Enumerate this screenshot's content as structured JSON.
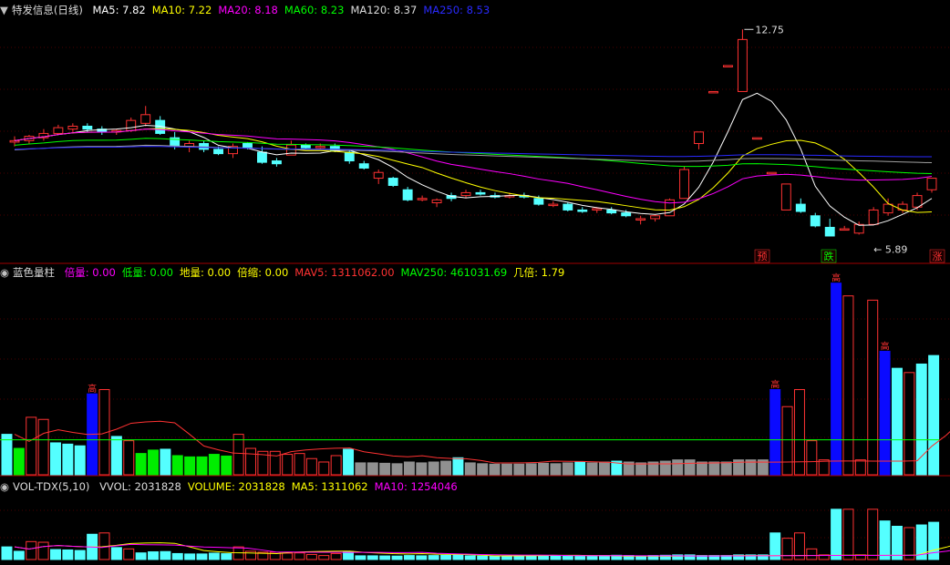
{
  "colors": {
    "up": "#ff3232",
    "down": "#54ffff",
    "ma5": "#ffffff",
    "ma10": "#ffff00",
    "ma20": "#ff00ff",
    "ma60": "#00ff00",
    "ma120": "#a0a0a0",
    "ma250": "#2a2aff",
    "grid": "#4a0000",
    "sep": "#a00000",
    "blue": "#0a0aff",
    "green": "#00ee00",
    "gray": "#909090",
    "orange": "#ff9900"
  },
  "panel1": {
    "title": "特发信息(日线)",
    "ma": [
      {
        "label": "MA5: 7.82",
        "color": "#ffffff"
      },
      {
        "label": "MA10: 7.22",
        "color": "#ffff00"
      },
      {
        "label": "MA20: 8.18",
        "color": "#ff00ff"
      },
      {
        "label": "MA60: 8.23",
        "color": "#00ff00"
      },
      {
        "label": "MA120: 8.37",
        "color": "#dcdcdc"
      },
      {
        "label": "MA250: 8.53",
        "color": "#2a2aff"
      }
    ],
    "high_label": "12.75",
    "low_label": "5.89",
    "markers": [
      {
        "text": "预",
        "color": "#ff3232",
        "index": 33
      },
      {
        "text": "跌",
        "color": "#00ff00",
        "index": 36
      },
      {
        "text": "涨",
        "color": "#ff3232",
        "index": 41
      }
    ]
  },
  "panel2": {
    "title": "蓝色量柱",
    "stats": [
      {
        "label": "倍量: 0.00",
        "color": "#ff00ff"
      },
      {
        "label": "低量: 0.00",
        "color": "#00ff00"
      },
      {
        "label": "地量: 0.00",
        "color": "#ffff00"
      },
      {
        "label": "倍缩: 0.00",
        "color": "#ffff00"
      },
      {
        "label": "MAV5: 1311062.00",
        "color": "#ff3232"
      },
      {
        "label": "MAV250: 461031.69",
        "color": "#00ff00"
      },
      {
        "label": "几倍: 1.79",
        "color": "#ffff00"
      }
    ],
    "gao": "高"
  },
  "panel3": {
    "title": "VOL-TDX(5,10)",
    "stats": [
      {
        "label": "VVOL: 2031828",
        "color": "#dcdcdc"
      },
      {
        "label": "VOLUME: 2031828",
        "color": "#ffff00"
      },
      {
        "label": "MA5: 1311062",
        "color": "#ffff00"
      },
      {
        "label": "MA10: 1254046",
        "color": "#ff00ff"
      }
    ]
  },
  "chart_data": {
    "type": "candlestick",
    "ylim": [
      5.0,
      13.2
    ],
    "candles": [
      {
        "o": 8.85,
        "h": 9.05,
        "l": 8.7,
        "c": 8.9
      },
      {
        "o": 8.9,
        "h": 9.1,
        "l": 8.8,
        "c": 9.05
      },
      {
        "o": 9.0,
        "h": 9.3,
        "l": 8.9,
        "c": 9.15
      },
      {
        "o": 9.15,
        "h": 9.45,
        "l": 9.1,
        "c": 9.35
      },
      {
        "o": 9.3,
        "h": 9.5,
        "l": 9.2,
        "c": 9.4
      },
      {
        "o": 9.4,
        "h": 9.5,
        "l": 9.2,
        "c": 9.3
      },
      {
        "o": 9.3,
        "h": 9.4,
        "l": 9.1,
        "c": 9.2
      },
      {
        "o": 9.2,
        "h": 9.3,
        "l": 9.1,
        "c": 9.25
      },
      {
        "o": 9.25,
        "h": 9.7,
        "l": 9.2,
        "c": 9.6
      },
      {
        "o": 9.5,
        "h": 10.1,
        "l": 9.4,
        "c": 9.8
      },
      {
        "o": 9.6,
        "h": 9.75,
        "l": 9.1,
        "c": 9.15
      },
      {
        "o": 9.0,
        "h": 9.2,
        "l": 8.6,
        "c": 8.7
      },
      {
        "o": 8.7,
        "h": 8.9,
        "l": 8.5,
        "c": 8.8
      },
      {
        "o": 8.8,
        "h": 8.9,
        "l": 8.5,
        "c": 8.6
      },
      {
        "o": 8.6,
        "h": 8.7,
        "l": 8.4,
        "c": 8.45
      },
      {
        "o": 8.45,
        "h": 8.8,
        "l": 8.3,
        "c": 8.7
      },
      {
        "o": 8.8,
        "h": 8.85,
        "l": 8.6,
        "c": 8.65
      },
      {
        "o": 8.5,
        "h": 8.7,
        "l": 8.1,
        "c": 8.15
      },
      {
        "o": 8.2,
        "h": 8.3,
        "l": 8.0,
        "c": 8.1
      },
      {
        "o": 8.4,
        "h": 8.9,
        "l": 8.4,
        "c": 8.75
      },
      {
        "o": 8.75,
        "h": 8.8,
        "l": 8.6,
        "c": 8.65
      },
      {
        "o": 8.7,
        "h": 8.8,
        "l": 8.6,
        "c": 8.7
      },
      {
        "o": 8.7,
        "h": 8.8,
        "l": 8.5,
        "c": 8.55
      },
      {
        "o": 8.5,
        "h": 8.6,
        "l": 8.1,
        "c": 8.2
      },
      {
        "o": 8.1,
        "h": 8.2,
        "l": 7.9,
        "c": 7.95
      },
      {
        "o": 7.6,
        "h": 7.9,
        "l": 7.4,
        "c": 7.8
      },
      {
        "o": 7.6,
        "h": 7.65,
        "l": 7.3,
        "c": 7.35
      },
      {
        "o": 7.2,
        "h": 7.3,
        "l": 6.8,
        "c": 6.85
      },
      {
        "o": 6.9,
        "h": 7.0,
        "l": 6.8,
        "c": 6.9
      },
      {
        "o": 6.75,
        "h": 6.9,
        "l": 6.6,
        "c": 6.85
      },
      {
        "o": 7.0,
        "h": 7.1,
        "l": 6.8,
        "c": 6.9
      },
      {
        "o": 7.0,
        "h": 7.2,
        "l": 6.9,
        "c": 7.1
      },
      {
        "o": 7.1,
        "h": 7.2,
        "l": 7.0,
        "c": 7.05
      },
      {
        "o": 7.0,
        "h": 7.1,
        "l": 6.9,
        "c": 6.95
      },
      {
        "o": 7.0,
        "h": 7.1,
        "l": 6.9,
        "c": 7.0
      },
      {
        "o": 7.0,
        "h": 7.1,
        "l": 6.9,
        "c": 6.95
      },
      {
        "o": 6.9,
        "h": 7.0,
        "l": 6.65,
        "c": 6.7
      },
      {
        "o": 6.7,
        "h": 6.8,
        "l": 6.6,
        "c": 6.7
      },
      {
        "o": 6.7,
        "h": 6.75,
        "l": 6.45,
        "c": 6.5
      },
      {
        "o": 6.5,
        "h": 6.6,
        "l": 6.4,
        "c": 6.45
      },
      {
        "o": 6.5,
        "h": 6.6,
        "l": 6.4,
        "c": 6.55
      },
      {
        "o": 6.5,
        "h": 6.6,
        "l": 6.35,
        "c": 6.4
      },
      {
        "o": 6.4,
        "h": 6.5,
        "l": 6.25,
        "c": 6.3
      },
      {
        "o": 6.2,
        "h": 6.3,
        "l": 6.0,
        "c": 6.2
      },
      {
        "o": 6.2,
        "h": 6.35,
        "l": 6.1,
        "c": 6.3
      },
      {
        "o": 6.3,
        "h": 6.9,
        "l": 6.3,
        "c": 6.85
      },
      {
        "o": 6.9,
        "h": 8.0,
        "l": 6.9,
        "c": 7.9
      },
      {
        "o": 8.8,
        "h": 9.2,
        "l": 8.6,
        "c": 9.2
      },
      {
        "o": 10.6,
        "h": 10.6,
        "l": 10.6,
        "c": 10.6
      },
      {
        "o": 11.5,
        "h": 11.5,
        "l": 11.5,
        "c": 11.5
      },
      {
        "o": 10.6,
        "h": 12.75,
        "l": 10.6,
        "c": 12.4
      },
      {
        "o": 9.0,
        "h": 9.0,
        "l": 9.0,
        "c": 9.0
      },
      {
        "o": 7.8,
        "h": 7.8,
        "l": 7.8,
        "c": 7.8
      },
      {
        "o": 6.5,
        "h": 7.4,
        "l": 6.5,
        "c": 7.4
      },
      {
        "o": 6.7,
        "h": 6.9,
        "l": 6.4,
        "c": 6.45
      },
      {
        "o": 6.3,
        "h": 6.4,
        "l": 5.9,
        "c": 5.95
      },
      {
        "o": 5.9,
        "h": 6.2,
        "l": 5.89,
        "c": 5.6
      },
      {
        "o": 5.85,
        "h": 5.95,
        "l": 5.8,
        "c": 5.85
      },
      {
        "o": 5.7,
        "h": 6.1,
        "l": 5.65,
        "c": 6.0
      },
      {
        "o": 6.0,
        "h": 6.6,
        "l": 6.0,
        "c": 6.5
      },
      {
        "o": 6.4,
        "h": 6.9,
        "l": 6.3,
        "c": 6.7
      },
      {
        "o": 6.5,
        "h": 6.8,
        "l": 6.4,
        "c": 6.7
      },
      {
        "o": 6.6,
        "h": 7.1,
        "l": 6.5,
        "c": 7.0
      },
      {
        "o": 7.2,
        "h": 7.6,
        "l": 7.1,
        "c": 7.6
      }
    ],
    "volume": [
      {
        "v": 0.95,
        "s": "c"
      },
      {
        "v": 0.62,
        "s": "g"
      },
      {
        "v": 1.35,
        "s": "r"
      },
      {
        "v": 1.3,
        "s": "r"
      },
      {
        "v": 0.75,
        "s": "c"
      },
      {
        "v": 0.72,
        "s": "c"
      },
      {
        "v": 0.68,
        "s": "c"
      },
      {
        "v": 1.9,
        "s": "b"
      },
      {
        "v": 2.0,
        "s": "r"
      },
      {
        "v": 0.9,
        "s": "c"
      },
      {
        "v": 0.8,
        "s": "r"
      },
      {
        "v": 0.5,
        "s": "g"
      },
      {
        "v": 0.58,
        "s": "g"
      },
      {
        "v": 0.6,
        "s": "c"
      },
      {
        "v": 0.45,
        "s": "g"
      },
      {
        "v": 0.42,
        "s": "g"
      },
      {
        "v": 0.42,
        "s": "g"
      },
      {
        "v": 0.48,
        "s": "g"
      },
      {
        "v": 0.44,
        "s": "g"
      },
      {
        "v": 0.95,
        "s": "r"
      },
      {
        "v": 0.62,
        "s": "r"
      },
      {
        "v": 0.55,
        "s": "r"
      },
      {
        "v": 0.55,
        "s": "r"
      },
      {
        "v": 0.48,
        "s": "r"
      },
      {
        "v": 0.5,
        "s": "r"
      },
      {
        "v": 0.38,
        "s": "r"
      },
      {
        "v": 0.3,
        "s": "r"
      },
      {
        "v": 0.45,
        "s": "r"
      },
      {
        "v": 0.6,
        "s": "c"
      },
      {
        "v": 0.28,
        "s": "x"
      },
      {
        "v": 0.28,
        "s": "x"
      },
      {
        "v": 0.27,
        "s": "x"
      },
      {
        "v": 0.26,
        "s": "x"
      },
      {
        "v": 0.3,
        "s": "x"
      },
      {
        "v": 0.28,
        "s": "x"
      },
      {
        "v": 0.3,
        "s": "x"
      },
      {
        "v": 0.32,
        "s": "x"
      },
      {
        "v": 0.4,
        "s": "c"
      },
      {
        "v": 0.28,
        "s": "x"
      },
      {
        "v": 0.26,
        "s": "x"
      },
      {
        "v": 0.25,
        "s": "x"
      },
      {
        "v": 0.25,
        "s": "x"
      },
      {
        "v": 0.25,
        "s": "x"
      },
      {
        "v": 0.26,
        "s": "x"
      },
      {
        "v": 0.27,
        "s": "x"
      },
      {
        "v": 0.26,
        "s": "x"
      },
      {
        "v": 0.28,
        "s": "x"
      },
      {
        "v": 0.3,
        "s": "c"
      },
      {
        "v": 0.28,
        "s": "x"
      },
      {
        "v": 0.3,
        "s": "x"
      },
      {
        "v": 0.32,
        "s": "c"
      },
      {
        "v": 0.3,
        "s": "x"
      },
      {
        "v": 0.28,
        "s": "x"
      },
      {
        "v": 0.3,
        "s": "x"
      },
      {
        "v": 0.32,
        "s": "x"
      },
      {
        "v": 0.35,
        "s": "x"
      },
      {
        "v": 0.35,
        "s": "x"
      },
      {
        "v": 0.3,
        "s": "x"
      },
      {
        "v": 0.3,
        "s": "x"
      },
      {
        "v": 0.3,
        "s": "x"
      },
      {
        "v": 0.35,
        "s": "x"
      },
      {
        "v": 0.35,
        "s": "x"
      },
      {
        "v": 0.35,
        "s": "x"
      },
      {
        "v": 2.0,
        "s": "b"
      },
      {
        "v": 1.6,
        "s": "r"
      },
      {
        "v": 2.0,
        "s": "r"
      },
      {
        "v": 0.8,
        "s": "r"
      },
      {
        "v": 0.35,
        "s": "r"
      },
      {
        "v": 4.5,
        "s": "b"
      },
      {
        "v": 4.2,
        "s": "r"
      },
      {
        "v": 0.35,
        "s": "r"
      },
      {
        "v": 4.1,
        "s": "r"
      },
      {
        "v": 2.9,
        "s": "b"
      },
      {
        "v": 2.5,
        "s": "c"
      },
      {
        "v": 2.4,
        "s": "r"
      },
      {
        "v": 2.6,
        "s": "c"
      },
      {
        "v": 2.8,
        "s": "c"
      }
    ]
  }
}
